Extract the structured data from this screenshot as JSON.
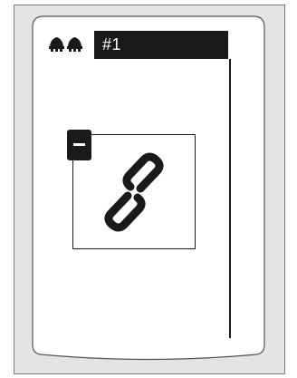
{
  "header": {
    "icon": "double-bell-icon",
    "title": "#1"
  },
  "item": {
    "action_icon": "minus-icon",
    "icon": "link-icon"
  },
  "colors": {
    "screen": "#ffffff",
    "frame": "#e3e3e3",
    "ink": "#1a1a1a"
  }
}
